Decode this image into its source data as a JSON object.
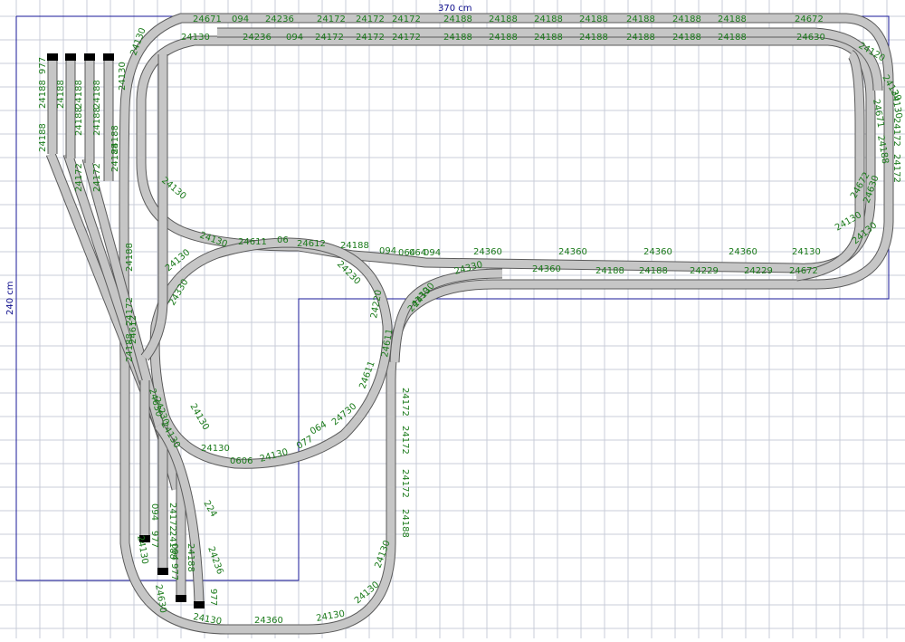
{
  "colors": {
    "grid": "#c8ccd8",
    "outline": "#1a1a9a",
    "track_fill": "#c6c6c6",
    "track_edge": "#5a5a5a",
    "label": "#1a7a1a",
    "buffer": "#000000"
  },
  "dimensions": {
    "width_label": "370 cm",
    "height_label": "240 cm"
  },
  "labels": {
    "top_outer": [
      "24671",
      "094",
      "24236",
      "24172",
      "24172",
      "24172",
      "24188",
      "24188",
      "24188",
      "24188",
      "24188",
      "24188",
      "24188",
      "24672"
    ],
    "top_inner": [
      "24130",
      "24236",
      "094",
      "24172",
      "24172",
      "24172",
      "24188",
      "24188",
      "24188",
      "24188",
      "24188",
      "24188",
      "24188",
      "24630"
    ],
    "right_curves": [
      "24120",
      "24130",
      "24130",
      "24671",
      "24188",
      "24172",
      "24172",
      "24672",
      "24130",
      "24130",
      "24630"
    ],
    "middle_row": [
      "24130",
      "24611",
      "06",
      "24612",
      "24188",
      "094",
      "064",
      "064",
      "094",
      "24360",
      "24360",
      "24360",
      "24360",
      "24130"
    ],
    "lower_row": [
      "24330",
      "24360",
      "24188",
      "24188",
      "24229",
      "24229",
      "24672"
    ],
    "left_vertical": [
      "24130",
      "24130",
      "24188",
      "24188",
      "24172",
      "24188",
      "24612",
      "24630",
      "24130"
    ],
    "yard_columns": [
      "977",
      "24188",
      "24188",
      "24172",
      "24172",
      "24188",
      "24188",
      "24188",
      "24188",
      "24188",
      "24188"
    ],
    "loop": [
      "24130",
      "24330",
      "24130",
      "24130",
      "24130",
      "24220",
      "24611",
      "24730",
      "064",
      "077",
      "24130",
      "0606",
      "24230",
      "24230",
      "24611",
      "24130"
    ],
    "right_vertical": [
      "24130",
      "24172",
      "24172",
      "24172",
      "24188",
      "24130",
      "24130"
    ],
    "bottom_row": [
      "24130",
      "24360",
      "24130"
    ],
    "sidings": [
      "094",
      "977",
      "24172",
      "24188",
      "094",
      "977",
      "24188",
      "24236",
      "224",
      "977",
      "24130",
      "24630"
    ]
  }
}
